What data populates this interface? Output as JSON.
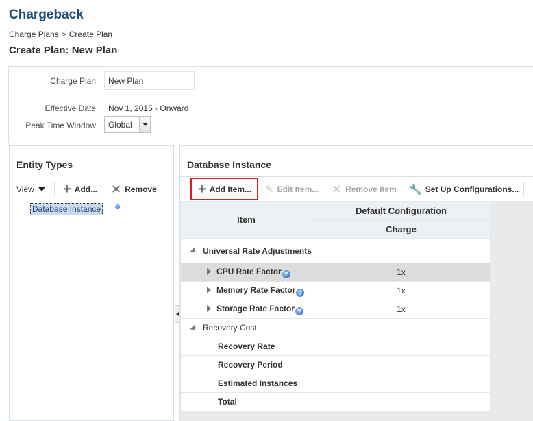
{
  "app": {
    "title": "Chargeback"
  },
  "breadcrumb": {
    "parent": "Charge Plans",
    "separator": ">",
    "current": "Create Plan"
  },
  "page": {
    "title": "Create Plan: New Plan"
  },
  "form": {
    "charge_plan_label": "Charge Plan",
    "charge_plan_value": "New Plan",
    "effective_date_label": "Effective Date",
    "effective_date_value": "Nov 1, 2015 - Onward",
    "peak_time_label": "Peak Time Window",
    "peak_time_value": "Global"
  },
  "entity_types": {
    "title": "Entity Types",
    "toolbar": {
      "view_label": "View",
      "add_label": "Add...",
      "remove_label": "Remove"
    },
    "tree": [
      {
        "label": "Database Instance",
        "selected": true
      }
    ]
  },
  "database_instance": {
    "title": "Database Instance",
    "toolbar": {
      "add_item_label": "Add Item...",
      "edit_item_label": "Edit Item...",
      "remove_item_label": "Remove Item",
      "setup_config_label": "Set Up Configurations..."
    },
    "grid": {
      "col_item": "Item",
      "col_group": "Default Configuration",
      "col_charge": "Charge",
      "rows": [
        {
          "label": "Universal Rate Adjustments",
          "charge": ""
        },
        {
          "label": "CPU Rate Factor",
          "charge": "1x"
        },
        {
          "label": "Memory Rate Factor",
          "charge": "1x"
        },
        {
          "label": "Storage Rate Factor",
          "charge": "1x"
        },
        {
          "label": "Recovery Cost",
          "charge": ""
        },
        {
          "label": "Recovery Rate",
          "charge": ""
        },
        {
          "label": "Recovery Period",
          "charge": ""
        },
        {
          "label": "Estimated Instances",
          "charge": ""
        },
        {
          "label": "Total",
          "charge": ""
        }
      ]
    }
  },
  "colors": {
    "title": "#1f4e79",
    "highlight": "#e21b1b",
    "selected_row": "#dcdcdc"
  }
}
